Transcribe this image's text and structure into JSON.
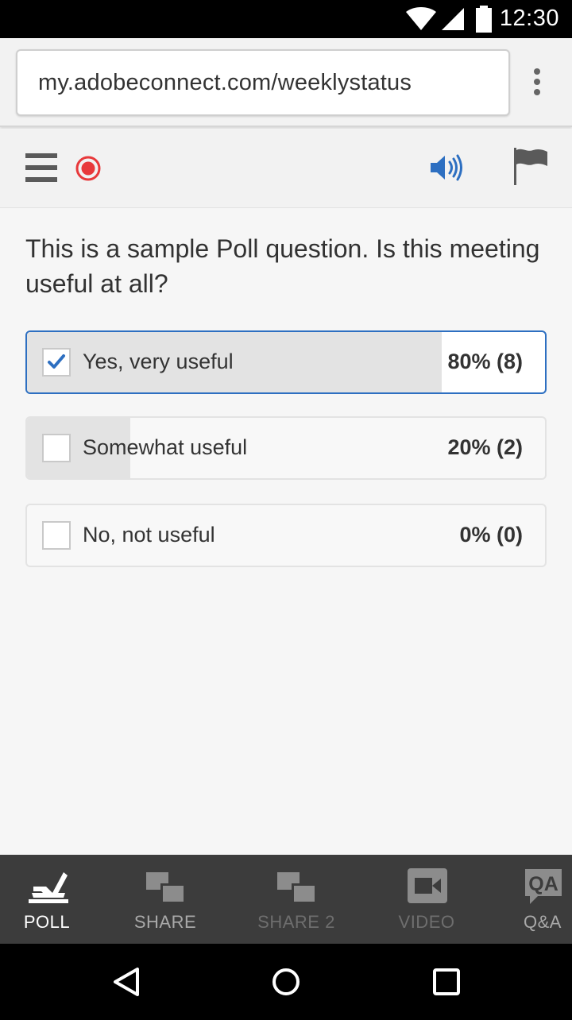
{
  "status_bar": {
    "time": "12:30",
    "icons": [
      "wifi-icon",
      "cell-signal-icon",
      "battery-icon"
    ]
  },
  "browser": {
    "url": "my.adobeconnect.com/weeklystatus",
    "menu_icon": "overflow-menu-icon"
  },
  "toolbar": {
    "icons": [
      "hamburger-menu-icon",
      "record-icon",
      "speaker-icon",
      "flag-icon"
    ],
    "accent_color": "#2d6fc1",
    "record_color": "#e8393b"
  },
  "poll": {
    "question": "This is a sample Poll question. Is this meeting useful at all?",
    "options": [
      {
        "label": "Yes, very useful",
        "result": "80% (8)",
        "checked": true,
        "percent": 80
      },
      {
        "label": "Somewhat useful",
        "result": "20% (2)",
        "checked": false,
        "percent": 20
      },
      {
        "label": "No, not useful",
        "result": "0% (0)",
        "checked": false,
        "percent": 0
      }
    ]
  },
  "tabs": [
    {
      "label": "POLL",
      "icon": "poll-checkmark-icon",
      "state": "active"
    },
    {
      "label": "SHARE",
      "icon": "share-icon",
      "state": "normal"
    },
    {
      "label": "SHARE 2",
      "icon": "share-icon",
      "state": "dimmed"
    },
    {
      "label": "VIDEO",
      "icon": "video-camera-icon",
      "state": "dimmed"
    },
    {
      "label": "Q&A",
      "icon": "qa-icon",
      "state": "normal"
    }
  ],
  "nav": {
    "icons": [
      "back-icon",
      "home-icon",
      "recents-icon"
    ]
  }
}
